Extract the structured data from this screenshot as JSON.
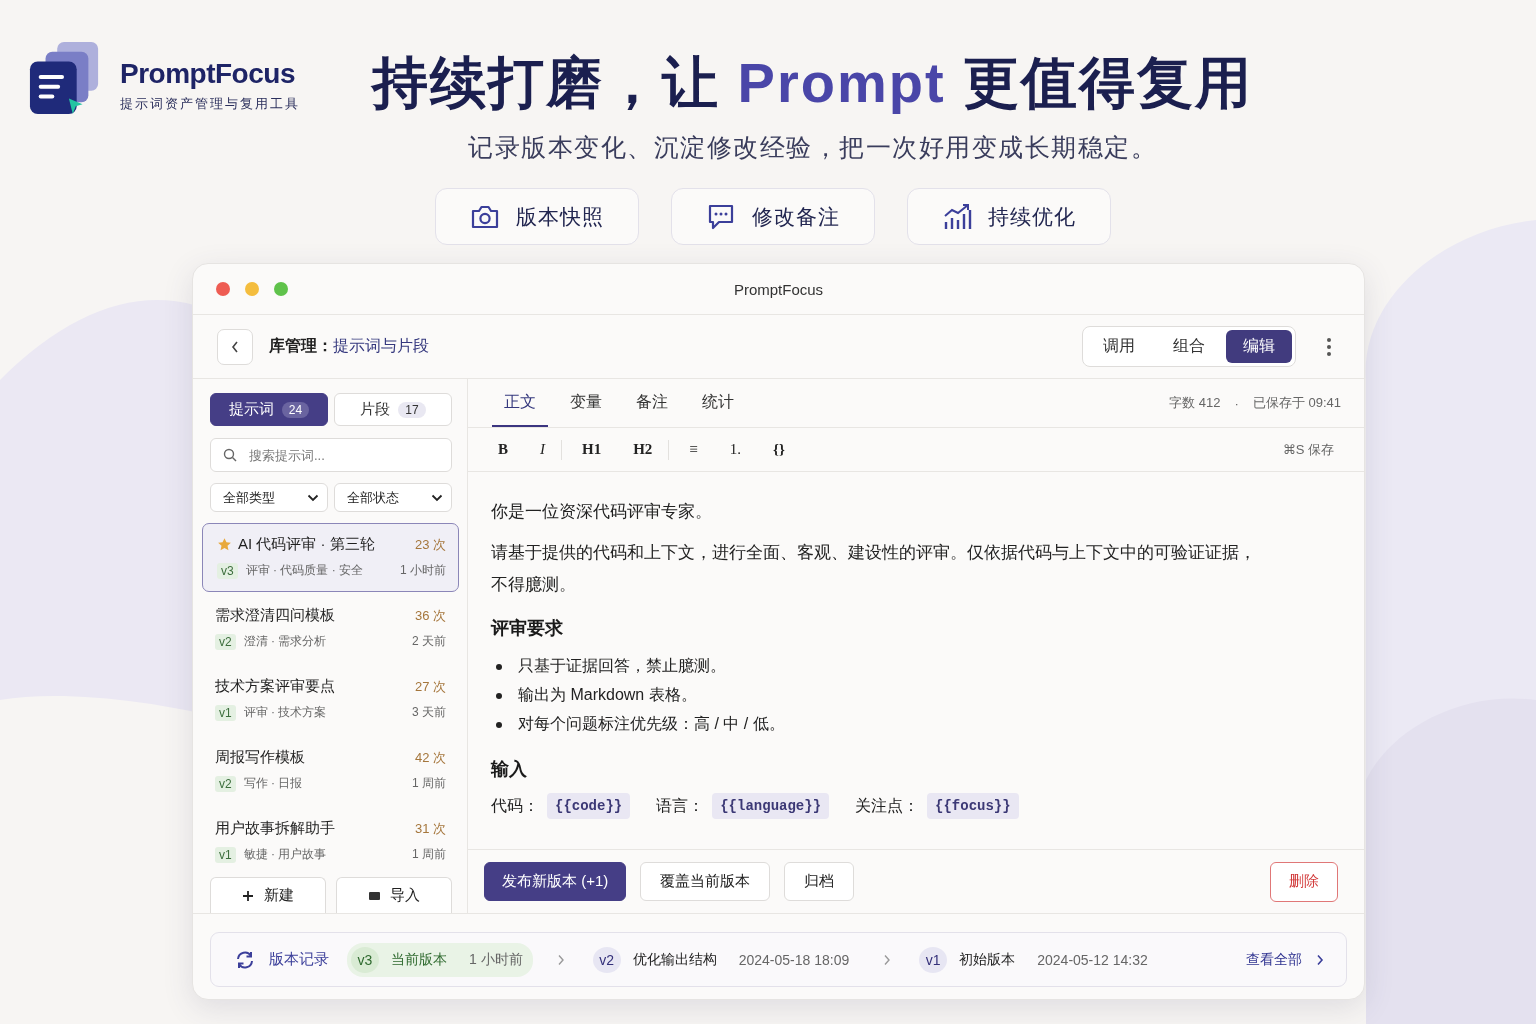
{
  "brand": {
    "name": "PromptFocus",
    "tagline": "提示词资产管理与复用工具"
  },
  "hero": {
    "title_parts": [
      {
        "text": "持续打磨，让 ",
        "accent": false
      },
      {
        "text": "Prompt",
        "accent": true
      },
      {
        "text": " 更值得复用",
        "accent": false
      }
    ],
    "subtitle": "记录版本变化、沉淀修改经验，把一次好用变成长期稳定。",
    "features": [
      {
        "label": "版本快照",
        "kind": "camera"
      },
      {
        "label": "修改备注",
        "kind": "chat"
      },
      {
        "label": "持续优化",
        "kind": "chart"
      }
    ]
  },
  "window": {
    "title": "PromptFocus"
  },
  "header": {
    "breadcrumb_label": "库管理：",
    "breadcrumb_value": "提示词与片段",
    "modes": [
      {
        "label": "调用",
        "selected": false
      },
      {
        "label": "组合",
        "selected": false
      },
      {
        "label": "编辑",
        "selected": true
      }
    ]
  },
  "sidebar": {
    "tabs": [
      {
        "label": "提示词",
        "count": "24",
        "selected": true
      },
      {
        "label": "片段",
        "count": "17",
        "selected": false
      }
    ],
    "search": {
      "placeholder": "搜索提示词..."
    },
    "filters": [
      {
        "label": "全部类型"
      },
      {
        "label": "全部状态"
      }
    ],
    "items": [
      {
        "title": "AI 代码评审 · 第三轮",
        "starred": true,
        "count": "23 次",
        "version": "v3",
        "tags": "评审 · 代码质量 · 安全",
        "time": "1 小时前",
        "selected": true
      },
      {
        "title": "需求澄清四问模板",
        "starred": false,
        "count": "36 次",
        "version": "v2",
        "tags": "澄清 · 需求分析",
        "time": "2 天前",
        "selected": false
      },
      {
        "title": "技术方案评审要点",
        "starred": false,
        "count": "27 次",
        "version": "v1",
        "tags": "评审 · 技术方案",
        "time": "3 天前",
        "selected": false
      },
      {
        "title": "周报写作模板",
        "starred": false,
        "count": "42 次",
        "version": "v2",
        "tags": "写作 · 日报",
        "time": "1 周前",
        "selected": false
      },
      {
        "title": "用户故事拆解助手",
        "starred": false,
        "count": "31 次",
        "version": "v1",
        "tags": "敏捷 · 用户故事",
        "time": "1 周前",
        "selected": false
      }
    ],
    "buttons": [
      {
        "label": "新建",
        "kind": "new"
      },
      {
        "label": "导入",
        "kind": "import"
      }
    ]
  },
  "editor": {
    "tabs": [
      {
        "label": "正文",
        "selected": true
      },
      {
        "label": "变量",
        "selected": false
      },
      {
        "label": "备注",
        "selected": false
      },
      {
        "label": "统计",
        "selected": false
      }
    ],
    "word_count": "字数 412",
    "separator": "·",
    "saved": "已保存于 09:41",
    "toolbar": [
      {
        "items": [
          {
            "label": "B",
            "kind": "bold"
          },
          {
            "label": "I",
            "kind": "italic"
          }
        ]
      },
      {
        "items": [
          {
            "label": "H1",
            "kind": "heading"
          },
          {
            "label": "H2",
            "kind": "heading"
          }
        ]
      },
      {
        "items": [
          {
            "label": "≡",
            "kind": "list"
          },
          {
            "label": "1.",
            "kind": "list"
          },
          {
            "label": "{}",
            "kind": "code"
          }
        ]
      }
    ],
    "shortcut": "⌘S 保存",
    "content": [
      {
        "kind": "paragraph",
        "text": "你是一位资深代码评审专家。"
      },
      {
        "kind": "paragraph",
        "text": "请基于提供的代码和上下文，进行全面、客观、建设性的评审。仅依据代码与上下文中的可验证证据，不得臆测。"
      },
      {
        "kind": "heading",
        "text": "评审要求"
      },
      {
        "kind": "bullets",
        "items": [
          "只基于证据回答，禁止臆测。",
          "输出为 Markdown 表格。",
          "对每个问题标注优先级：高 / 中 / 低。"
        ]
      },
      {
        "kind": "heading",
        "text": "输入"
      },
      {
        "kind": "variables",
        "items": [
          {
            "label": "代码：",
            "value": "{{code}}"
          },
          {
            "label": "语言：",
            "value": "{{language}}"
          },
          {
            "label": "关注点：",
            "value": "{{focus}}"
          }
        ]
      }
    ],
    "actions": [
      {
        "label": "发布新版本 (+1)",
        "kind": "primary"
      },
      {
        "label": "覆盖当前版本",
        "kind": "secondary"
      },
      {
        "label": "归档",
        "kind": "secondary"
      },
      {
        "label": "删除",
        "kind": "danger"
      }
    ]
  },
  "history": {
    "label": "版本记录",
    "entries": [
      {
        "version": "v3",
        "name": "当前版本",
        "time": "1 小时前",
        "current": true
      },
      {
        "version": "v2",
        "name": "优化输出结构",
        "time": "2024-05-18 18:09",
        "current": false
      },
      {
        "version": "v1",
        "name": "初始版本",
        "time": "2024-05-12 14:32",
        "current": false
      }
    ],
    "view_all": "查看全部"
  }
}
